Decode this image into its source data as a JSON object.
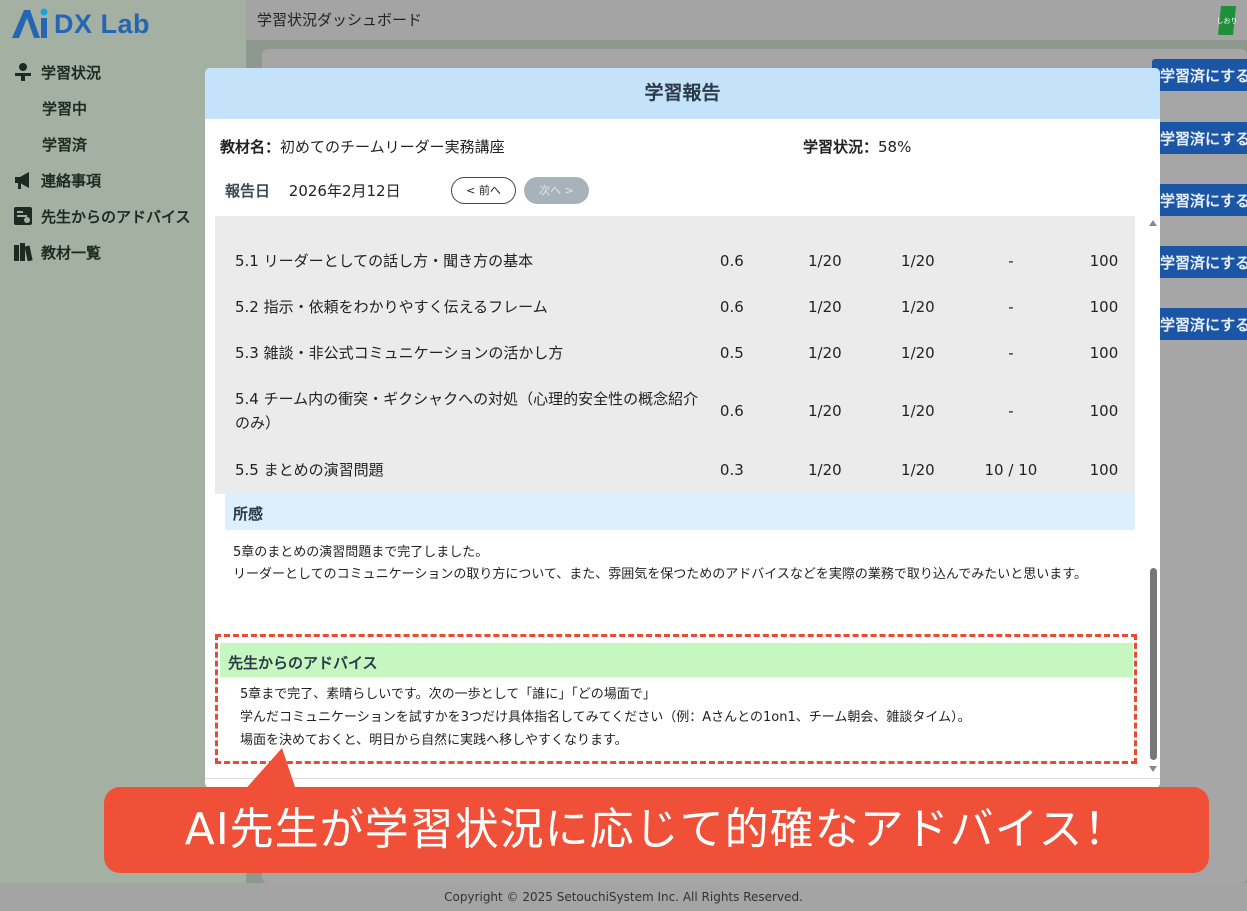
{
  "brand": {
    "name": "DX Lab"
  },
  "sidebar": {
    "items": [
      {
        "label": "学習状況",
        "icon": "learner-icon"
      },
      {
        "label": "学習中",
        "sub": true
      },
      {
        "label": "学習済",
        "sub": true
      },
      {
        "label": "連絡事項",
        "icon": "megaphone-icon"
      },
      {
        "label": "先生からのアドバイス",
        "icon": "advice-icon"
      },
      {
        "label": "教材一覧",
        "icon": "books-icon"
      }
    ]
  },
  "header": {
    "title": "学習状況ダッシュボード",
    "bookmark_label": "しおり"
  },
  "side_buttons": [
    "学習済にする",
    "学習済にする",
    "学習済にする",
    "学習済にする",
    "学習済にする"
  ],
  "modal": {
    "title": "学習報告",
    "material_label": "教材名：",
    "material_name": "初めてのチームリーダー実務講座",
    "status_label": "学習状況：",
    "status_value": "58%",
    "date_label": "報告日",
    "date_value": "2026年2月12日",
    "prev_label": "< 前へ",
    "next_label": "次へ >",
    "units": [
      {
        "name": "5.1 リーダーとしての話し方・聞き方の基本",
        "c1": "0.6",
        "c2": "1/20",
        "c3": "1/20",
        "c4": "-",
        "c5": "100"
      },
      {
        "name": "5.2 指示・依頼をわかりやすく伝えるフレーム",
        "c1": "0.6",
        "c2": "1/20",
        "c3": "1/20",
        "c4": "-",
        "c5": "100"
      },
      {
        "name": "5.3 雑談・非公式コミュニケーションの活かし方",
        "c1": "0.5",
        "c2": "1/20",
        "c3": "1/20",
        "c4": "-",
        "c5": "100"
      },
      {
        "name": "5.4 チーム内の衝突・ギクシャクへの対処（心理的安全性の概念紹介のみ）",
        "c1": "0.6",
        "c2": "1/20",
        "c3": "1/20",
        "c4": "-",
        "c5": "100"
      },
      {
        "name": "5.5 まとめの演習問題",
        "c1": "0.3",
        "c2": "1/20",
        "c3": "1/20",
        "c4": "10 / 10",
        "c5": "100"
      }
    ],
    "reflection_title": "所感",
    "reflection_lines": [
      "5章のまとめの演習問題まで完了しました。",
      "リーダーとしてのコミュニケーションの取り方について、また、雰囲気を保つためのアドバイスなどを実際の業務で取り込んでみたいと思います。"
    ],
    "advice_title": "先生からのアドバイス",
    "advice_lines": [
      "5章まで完了、素晴らしいです。次の一歩として「誰に」「どの場面で」",
      "学んだコミュニケーションを試すかを3つだけ具体指名してみてください（例：Aさんとの1on1、チーム朝会、雑談タイム）。",
      "場面を決めておくと、明日から自然に実践へ移しやすくなります。"
    ]
  },
  "callout": {
    "text": "AI先生が学習状況に応じて的確なアドバイス！"
  },
  "footer": {
    "copyright": "Copyright © 2025 SetouchiSystem Inc. All Rights Reserved."
  },
  "colors": {
    "accent": "#1b56a6",
    "callout": "#f04f38",
    "modal_header": "#c4e3fb",
    "advice_header": "#c6f7c0"
  }
}
